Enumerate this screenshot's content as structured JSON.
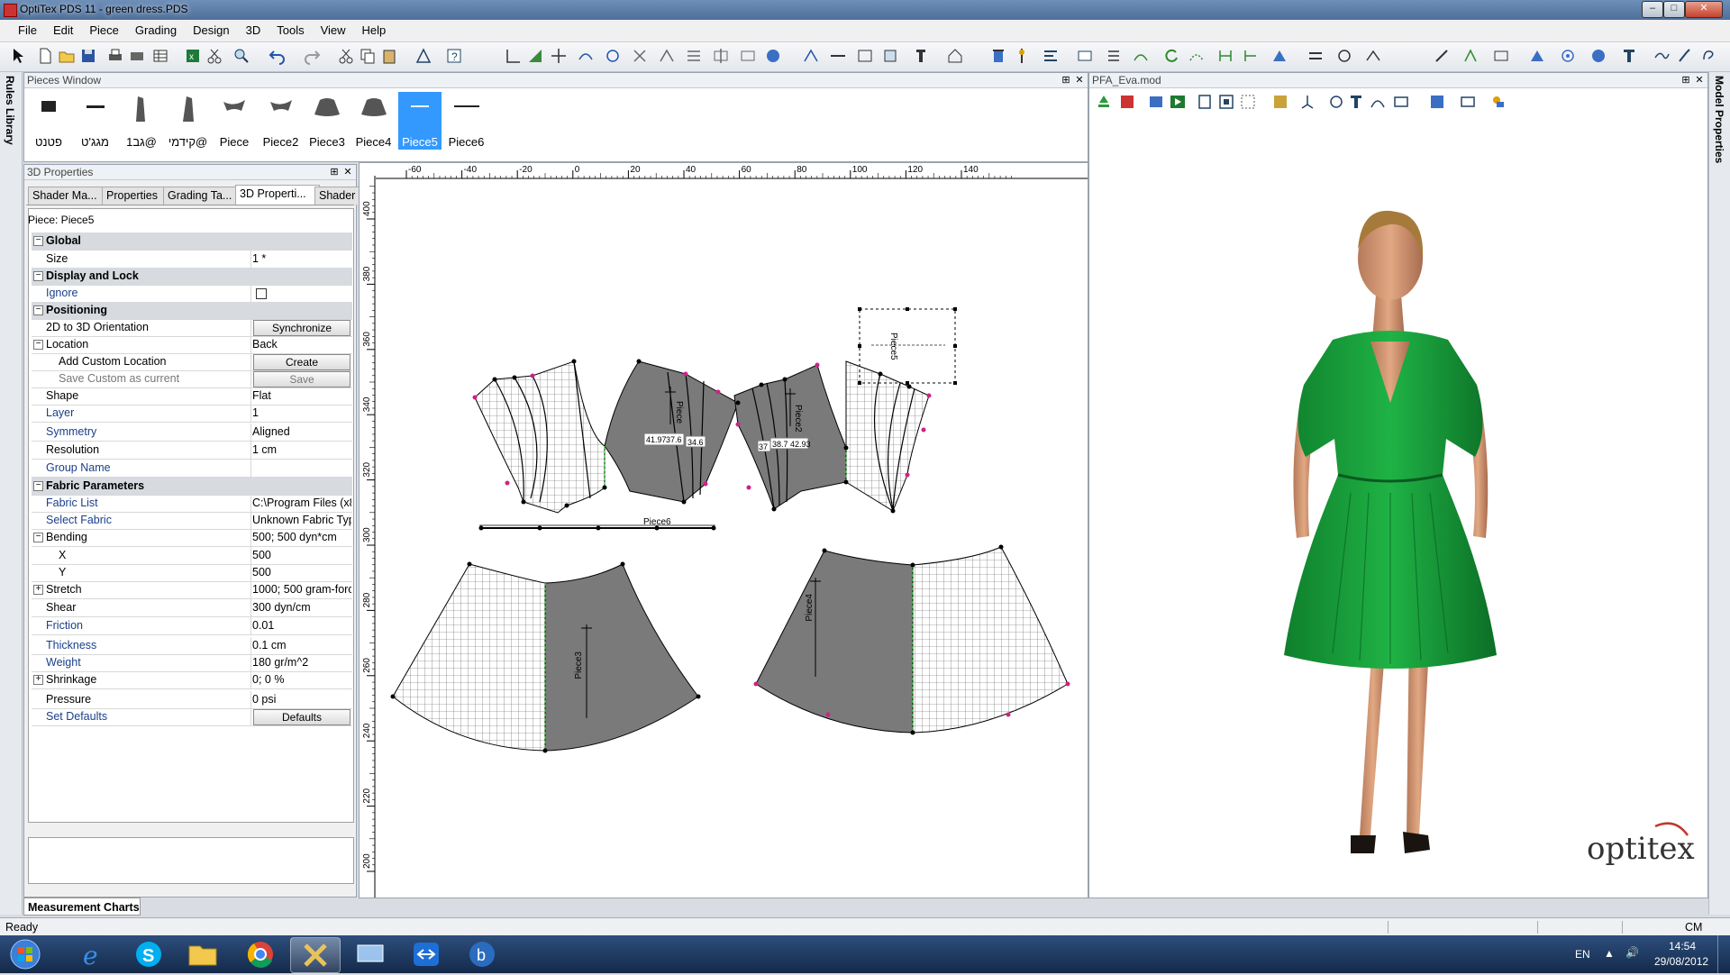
{
  "window": {
    "title": "OptiTex PDS 11 - green dress.PDS"
  },
  "menu": [
    "File",
    "Edit",
    "Piece",
    "Grading",
    "Design",
    "3D",
    "Tools",
    "View",
    "Help"
  ],
  "side_tabs": {
    "left": "Rules Library",
    "right": "Model Properties"
  },
  "pieces_window": {
    "title": "Pieces Window",
    "pieces": [
      {
        "label": "פטנט",
        "selected": false
      },
      {
        "label": "מגג'ט",
        "selected": false
      },
      {
        "label": "גב1@",
        "selected": false
      },
      {
        "label": "קידמי@",
        "selected": false
      },
      {
        "label": "Piece",
        "selected": false
      },
      {
        "label": "Piece2",
        "selected": false
      },
      {
        "label": "Piece3",
        "selected": false
      },
      {
        "label": "Piece4",
        "selected": false
      },
      {
        "label": "Piece5",
        "selected": true
      },
      {
        "label": "Piece6",
        "selected": false
      }
    ]
  },
  "properties": {
    "title": "3D Properties",
    "tabs": [
      "Shader Ma...",
      "Properties",
      "Grading Ta...",
      "3D Properti...",
      "Shader"
    ],
    "active_tab": "3D Properti...",
    "piece_caption": "Piece: Piece5",
    "rows": [
      {
        "kind": "group",
        "key": "Global"
      },
      {
        "kind": "prop",
        "key": "Size",
        "value": "1 *"
      },
      {
        "kind": "group",
        "key": "Display and Lock"
      },
      {
        "kind": "prop",
        "key": "Ignore",
        "value": "",
        "checkbox": true,
        "style": "blue"
      },
      {
        "kind": "group",
        "key": "Positioning"
      },
      {
        "kind": "prop",
        "key": "2D to 3D Orientation",
        "value": "Synchronize",
        "button": true
      },
      {
        "kind": "prop",
        "key": "Location",
        "value": "Back",
        "expander": "minus"
      },
      {
        "kind": "prop",
        "key": "Add Custom Location",
        "value": "Create",
        "button": true,
        "indent": true
      },
      {
        "kind": "prop",
        "key": "Save Custom as current",
        "value": "Save",
        "button": true,
        "indent": true,
        "style": "gray"
      },
      {
        "kind": "prop",
        "key": "Shape",
        "value": "Flat"
      },
      {
        "kind": "prop",
        "key": "Layer",
        "value": "1",
        "style": "blue"
      },
      {
        "kind": "prop",
        "key": "Symmetry",
        "value": "Aligned",
        "style": "blue"
      },
      {
        "kind": "prop",
        "key": "Resolution",
        "value": "1 cm"
      },
      {
        "kind": "prop",
        "key": "Group Name",
        "value": "",
        "style": "blue"
      },
      {
        "kind": "group",
        "key": "Fabric Parameters"
      },
      {
        "kind": "prop",
        "key": "Fabric List",
        "value": "C:\\Program Files (x86",
        "style": "blue"
      },
      {
        "kind": "prop",
        "key": "Select Fabric",
        "value": "Unknown Fabric Typ",
        "style": "blue"
      },
      {
        "kind": "prop",
        "key": "Bending",
        "value": "500; 500 dyn*cm",
        "expander": "minus"
      },
      {
        "kind": "prop",
        "key": "X",
        "value": "500",
        "indent": true
      },
      {
        "kind": "prop",
        "key": "Y",
        "value": "500",
        "indent": true
      },
      {
        "kind": "prop",
        "key": "Stretch",
        "value": "1000; 500 gram-force",
        "expander": "plus"
      },
      {
        "kind": "prop",
        "key": "Shear",
        "value": "300 dyn/cm"
      },
      {
        "kind": "prop",
        "key": "Friction",
        "value": "0.01",
        "style": "blue"
      },
      {
        "kind": "prop",
        "key": "Thickness",
        "value": "0.1 cm",
        "style": "blue"
      },
      {
        "kind": "prop",
        "key": "Weight",
        "value": "180 gr/m^2",
        "style": "blue"
      },
      {
        "kind": "prop",
        "key": "Shrinkage",
        "value": "0; 0 %",
        "expander": "plus"
      },
      {
        "kind": "prop",
        "key": "Pressure",
        "value": "0 psi"
      },
      {
        "kind": "prop",
        "key": "Set Defaults",
        "value": "Defaults",
        "button": true,
        "style": "blue"
      }
    ]
  },
  "measurement_tab": "Measurement Charts",
  "canvas": {
    "ruler_top": [
      "-60",
      "-40",
      "-20",
      "0",
      "20",
      "40",
      "60",
      "80",
      "100",
      "120",
      "140"
    ],
    "ruler_left": [
      "400",
      "380",
      "360",
      "340",
      "320",
      "300",
      "280",
      "260",
      "240",
      "220",
      "200"
    ],
    "piece_labels": [
      "Piece",
      "Piece2",
      "Piece3",
      "Piece4",
      "Piece5",
      "Piece6"
    ],
    "measurements_left": [
      "41.97",
      "37.6",
      "34.6"
    ],
    "measurements_right": [
      "37",
      "38.7",
      "42.93"
    ]
  },
  "view3d": {
    "title": "PFA_Eva.mod",
    "brand": "optitex",
    "dress_color": "#14a03a"
  },
  "status": {
    "text": "Ready",
    "units": "CM"
  },
  "taskbar": {
    "lang": "EN",
    "time": "14:54",
    "date": "29/08/2012"
  },
  "colors": {
    "selection": "#3399ff",
    "piece_fill": "#7a7a7a",
    "handle": "#cc2288"
  }
}
